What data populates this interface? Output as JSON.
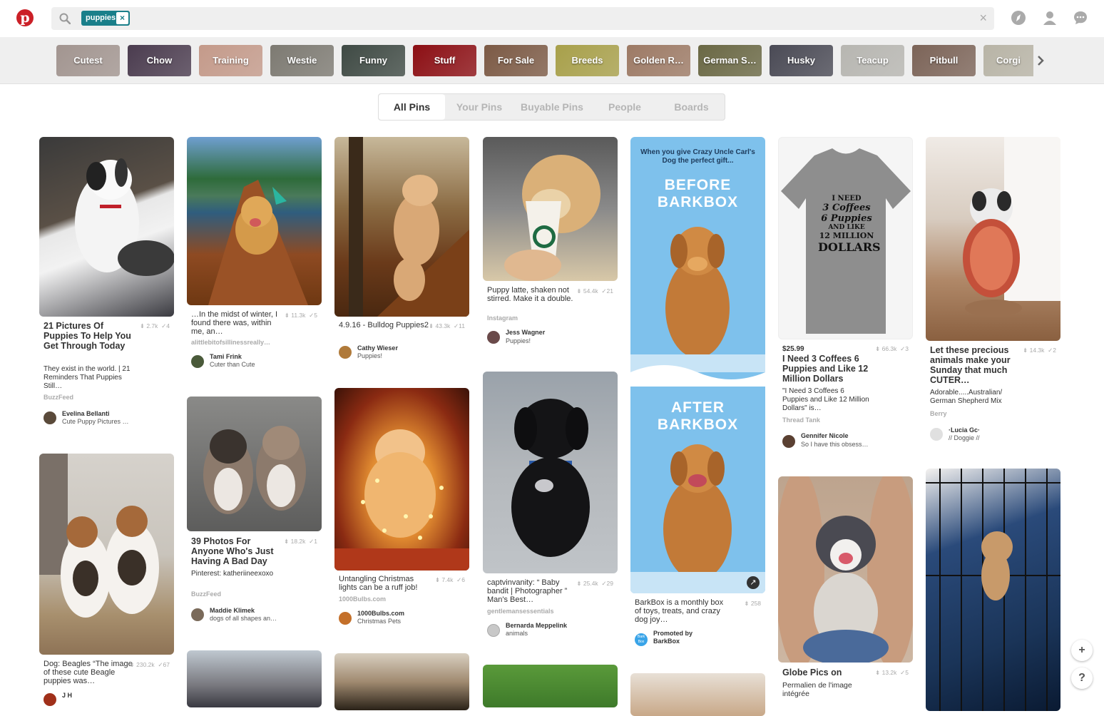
{
  "header": {
    "logo_letter": "p",
    "search_chip": "puppies",
    "chip_close": "×",
    "clear_label": "×"
  },
  "categories": [
    {
      "label": "Cutest",
      "color": "#a29590"
    },
    {
      "label": "Chow",
      "color": "#4b3c4f"
    },
    {
      "label": "Training",
      "color": "#c49a8a"
    },
    {
      "label": "Westie",
      "color": "#7d7a72"
    },
    {
      "label": "Funny",
      "color": "#3f4a44"
    },
    {
      "label": "Stuff",
      "color": "#8c0f14"
    },
    {
      "label": "For Sale",
      "color": "#7c5a45"
    },
    {
      "label": "Breeds",
      "color": "#a8a04a"
    },
    {
      "label": "Golden R…",
      "color": "#9d7a65"
    },
    {
      "label": "German S…",
      "color": "#6a6844"
    },
    {
      "label": "Husky",
      "color": "#4a4a55"
    },
    {
      "label": "Teacup",
      "color": "#b7b6b1"
    },
    {
      "label": "Pitbull",
      "color": "#7c6458"
    },
    {
      "label": "Corgi",
      "color": "#b8b4a6"
    }
  ],
  "tabs": [
    "All Pins",
    "Your Pins",
    "Buyable Pins",
    "People",
    "Boards"
  ],
  "pins": [
    {
      "title": "21 Pictures Of Puppies To Help You Get Through Today",
      "saves": "2.7k",
      "likes": "4",
      "desc": "They exist in the world. | 21 Reminders That Puppies Still…",
      "source": "BuzzFeed",
      "user": "Evelina Bellanti",
      "board": "Cute Puppy Pictures …"
    },
    {
      "title": "Dog: Beagles “The image of these cute Beagle puppies was…",
      "saves": "230.2k",
      "likes": "67",
      "user": "J H"
    },
    {
      "title": "…In the midst of winter, I found there was, within me, an…",
      "saves": "11.3k",
      "likes": "5",
      "source": "alittlebitofsillinessreally…",
      "user": "Tami Frink",
      "board": "Cuter than Cute"
    },
    {
      "title": "39 Photos For Anyone Who's Just Having A Bad Day",
      "saves": "18.2k",
      "likes": "1",
      "desc": "Pinterest: katheriineexoxo",
      "source": "BuzzFeed",
      "user": "Maddie Klimek",
      "board": "dogs of all shapes an…"
    },
    {
      "title": "4.9.16 - Bulldog Puppies2",
      "saves": "43.3k",
      "likes": "11",
      "user": "Cathy Wieser",
      "board": "Puppies!"
    },
    {
      "title": "Untangling Christmas lights can be a ruff job!",
      "saves": "7.4k",
      "likes": "6",
      "source": "1000Bulbs.com",
      "user": "1000Bulbs.com",
      "board": "Christmas Pets"
    },
    {
      "title": "Puppy latte, shaken not stirred. Make it a double.",
      "saves": "54.4k",
      "likes": "21",
      "source": "Instagram",
      "user": "Jess Wagner",
      "board": "Puppies!"
    },
    {
      "title": "captvinvanity: “ Baby bandit | Photographer ” Man's Best…",
      "saves": "25.4k",
      "likes": "29",
      "source": "gentlemansessentials",
      "user": "Bernarda Meppelink",
      "board": "animals"
    },
    {
      "title": "BarkBox is a monthly box of toys, treats, and crazy dog joy…",
      "saves": "258",
      "promoted": "Promoted by",
      "user": "BarkBox",
      "ad_top": "When you give Crazy Uncle Carl's Dog the perfect gift...",
      "ad_before": "BEFORE BARKBOX",
      "ad_after": "AFTER BARKBOX",
      "avatar_text": "Bark Box"
    },
    {
      "price": "$25.99",
      "title": "I Need 3 Coffees 6 Puppies and Like 12 Million Dollars",
      "saves": "66.3k",
      "likes": "3",
      "desc": "\"I Need 3 Coffees 6 Puppies and Like 12 Million Dollars\" is…",
      "source": "Thread Tank",
      "user": "Gennifer Nicole",
      "board": "So I have this obsess…",
      "shirt": [
        "I NEED",
        "3 Coffees",
        "6 Puppies",
        "AND LIKE",
        "12 MILLION",
        "DOLLARS"
      ]
    },
    {
      "title": "Globe Pics on",
      "saves": "13.2k",
      "likes": "5",
      "desc": "Permalien de l'image intégrée"
    },
    {
      "title": "Let these precious animals make your Sunday that much CUTER…",
      "saves": "14.3k",
      "likes": "2",
      "desc": "Adorable.....Australian/ German Shepherd Mix",
      "source": "Berry",
      "user": "·Lucia Gc·",
      "board": "// Doggie //"
    }
  ],
  "fab": {
    "plus": "+",
    "help": "?"
  }
}
